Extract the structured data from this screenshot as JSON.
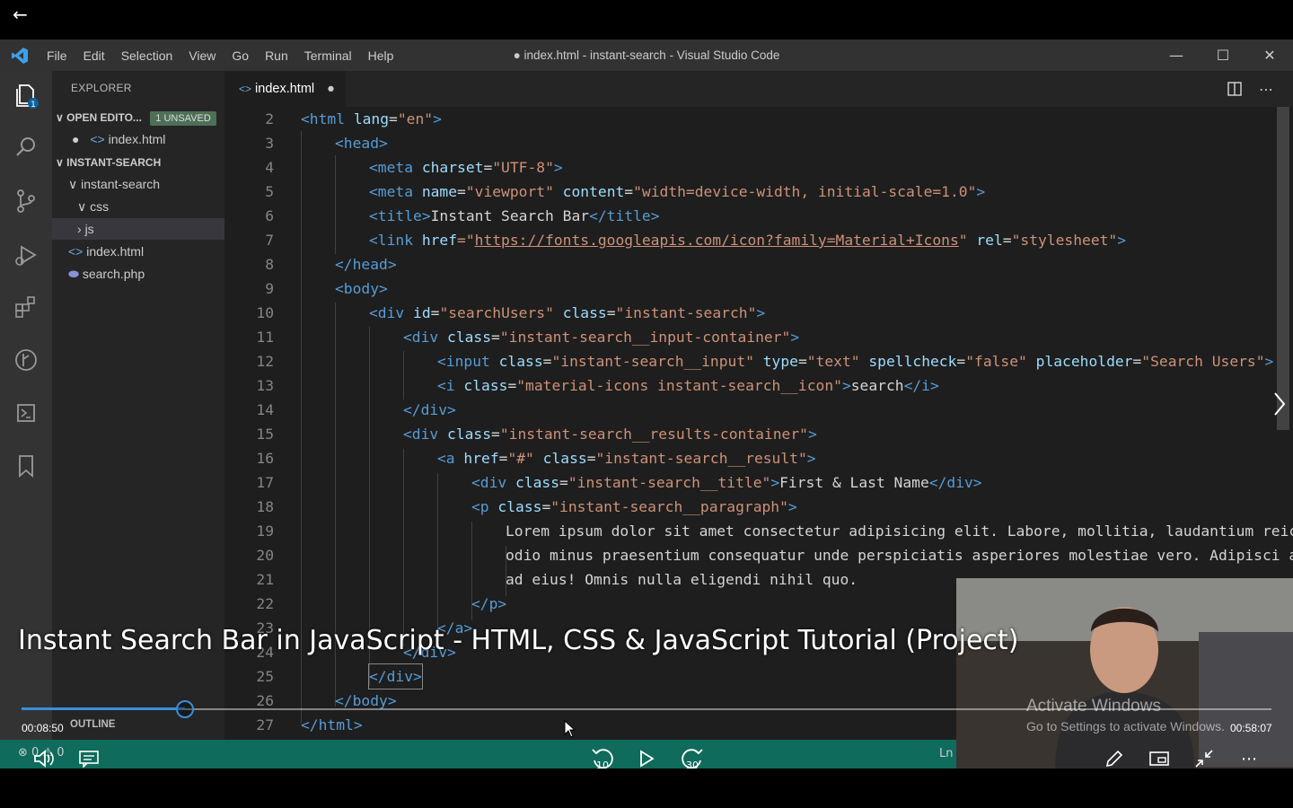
{
  "player": {
    "back_label": "←",
    "video_title": "Instant Search Bar in JavaScript - HTML, CSS & JavaScript Tutorial (Project)",
    "elapsed": "00:08:50",
    "remaining": "00:58:07",
    "progress_fraction": 0.1306,
    "skip_back_label": "10",
    "skip_forward_label": "30",
    "watermark_title": "Activate Windows",
    "watermark_sub": "Go to Settings to activate Windows.",
    "accent": "#3a8fd9"
  },
  "vscode": {
    "menu": [
      "File",
      "Edit",
      "Selection",
      "View",
      "Go",
      "Run",
      "Terminal",
      "Help"
    ],
    "window_title": "● index.html - instant-search - Visual Studio Code",
    "explorer_header": "EXPLORER",
    "open_editors_label": "OPEN EDITO...",
    "unsaved_badge": "1 UNSAVED",
    "open_file": "index.html",
    "project_label": "INSTANT-SEARCH",
    "tree": {
      "folder": "instant-search",
      "css": "css",
      "js": "js",
      "index": "index.html",
      "search": "search.php"
    },
    "outline_label": "OUTLINE",
    "tab_label": "index.html",
    "status_errors": "0",
    "status_ln": "Ln",
    "activity_badge": "1"
  },
  "code_lines": [
    {
      "n": "2"
    },
    {
      "n": "3"
    },
    {
      "n": "4"
    },
    {
      "n": "5"
    },
    {
      "n": "6"
    },
    {
      "n": "7"
    },
    {
      "n": "8"
    },
    {
      "n": "9"
    },
    {
      "n": "10"
    },
    {
      "n": "11"
    },
    {
      "n": "12"
    },
    {
      "n": "13"
    },
    {
      "n": "14"
    },
    {
      "n": "15"
    },
    {
      "n": "16"
    },
    {
      "n": "17"
    },
    {
      "n": "18"
    },
    {
      "n": "19"
    },
    {
      "n": "20"
    },
    {
      "n": "21"
    },
    {
      "n": "22"
    },
    {
      "n": "23"
    },
    {
      "n": "24"
    },
    {
      "n": "25"
    },
    {
      "n": "26"
    },
    {
      "n": "27"
    }
  ],
  "code": {
    "l2": [
      "<html",
      " lang",
      "=",
      "\"en\"",
      ">"
    ],
    "l3": "<head>",
    "l4": [
      "<meta",
      " charset",
      "=",
      "\"UTF-8\"",
      ">"
    ],
    "l5": [
      "<meta",
      " name",
      "=",
      "\"viewport\"",
      " content",
      "=",
      "\"width=device-width, initial-scale=1.0\"",
      ">"
    ],
    "l6": [
      "<title>",
      "Instant Search Bar",
      "</title>"
    ],
    "l7": [
      "<link",
      " href",
      "=\"",
      "https://fonts.googleapis.com/icon?family=Material+Icons",
      "\"",
      " rel",
      "=",
      "\"stylesheet\"",
      ">"
    ],
    "l8": "</head>",
    "l9": "<body>",
    "l10": [
      "<div",
      " id",
      "=",
      "\"searchUsers\"",
      " class",
      "=",
      "\"instant-search\"",
      ">"
    ],
    "l11": [
      "<div",
      " class",
      "=",
      "\"instant-search__input-container\"",
      ">"
    ],
    "l12": [
      "<input",
      " class",
      "=",
      "\"instant-search__input\"",
      " type",
      "=",
      "\"text\"",
      " spellcheck",
      "=",
      "\"false\"",
      " placeholder",
      "=",
      "\"Search Users\"",
      ">"
    ],
    "l13": [
      "<i",
      " class",
      "=",
      "\"material-icons instant-search__icon\"",
      ">",
      "search",
      "</i>"
    ],
    "l14": "</div>",
    "l15": [
      "<div",
      " class",
      "=",
      "\"instant-search__results-container\"",
      ">"
    ],
    "l16": [
      "<a",
      " href",
      "=",
      "\"#\"",
      " class",
      "=",
      "\"instant-search__result\"",
      ">"
    ],
    "l17": [
      "<div",
      " class",
      "=",
      "\"instant-search__title\"",
      ">",
      "First & Last Name",
      "</div>"
    ],
    "l18": [
      "<p",
      " class",
      "=",
      "\"instant-search__paragraph\"",
      ">"
    ],
    "l19": "Lorem ipsum dolor sit amet consectetur adipisicing elit. Labore, mollitia, laudantium reicie",
    "l20": "odio minus praesentium consequatur unde perspiciatis asperiores molestiae vero. Adipisci ali",
    "l21": "ad eius! Omnis nulla eligendi nihil quo.",
    "l22": "</p>",
    "l23": "</a>",
    "l24": "</div>",
    "l25": "</div>",
    "l26": "</body>",
    "l27": "</html>"
  }
}
